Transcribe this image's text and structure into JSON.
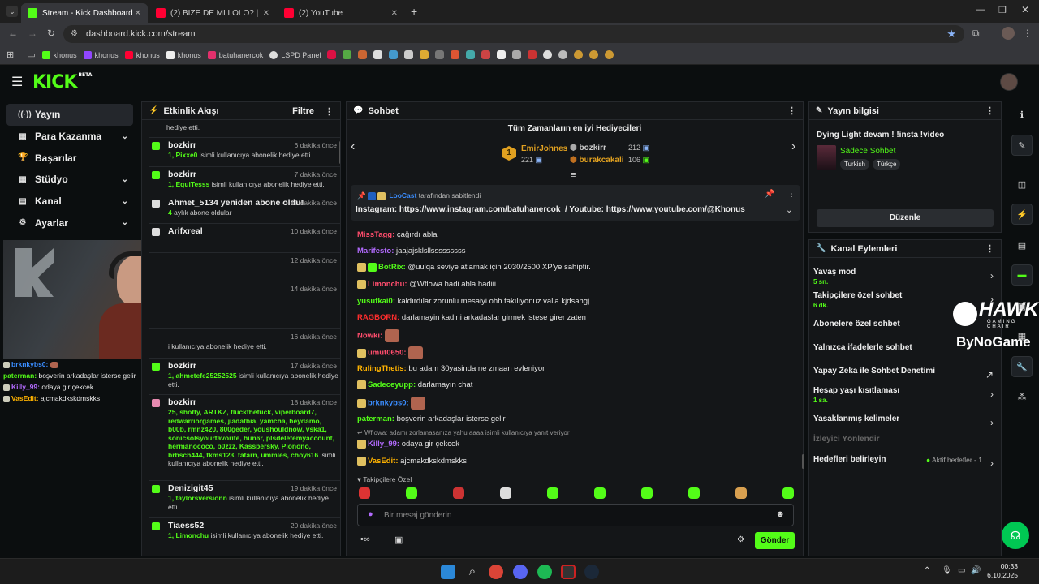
{
  "browser": {
    "tabs": [
      {
        "title": "Stream - Kick Dashboard",
        "color": "#53fc18"
      },
      {
        "title": "(2) BİZE DE Mİ LOLO? | 5Srider...",
        "color": "#ff0033"
      },
      {
        "title": "(2) YouTube",
        "color": "#ff0033"
      }
    ],
    "url": "dashboard.kick.com/stream",
    "bookmarks": [
      {
        "label": "khonus",
        "color": "#53fc18"
      },
      {
        "label": "khonus",
        "color": "#9146ff"
      },
      {
        "label": "khonus",
        "color": "#ff0033"
      },
      {
        "label": "khonus",
        "color": "#eeeeee"
      },
      {
        "label": "batuhanercok",
        "color": "#e1306c"
      },
      {
        "label": "LSPD Panel",
        "color": "#dddddd"
      }
    ]
  },
  "kick": {
    "logo": "KICK",
    "logo_badge": "BETA"
  },
  "nav": {
    "items": [
      {
        "label": "Yayın",
        "icon": "broadcast-icon",
        "glyph": "((·))",
        "chevron": false,
        "active": true
      },
      {
        "label": "Para Kazanma",
        "icon": "money-icon",
        "glyph": "▦",
        "chevron": true,
        "active": false
      },
      {
        "label": "Başarılar",
        "icon": "trophy-icon",
        "glyph": "🏆",
        "chevron": false,
        "active": false
      },
      {
        "label": "Stüdyo",
        "icon": "studio-icon",
        "glyph": "▦",
        "chevron": true,
        "active": false
      },
      {
        "label": "Kanal",
        "icon": "channel-icon",
        "glyph": "▤",
        "chevron": true,
        "active": false
      },
      {
        "label": "Ayarlar",
        "icon": "gear-icon",
        "glyph": "⚙",
        "chevron": true,
        "active": false
      }
    ]
  },
  "overlay_chat": [
    {
      "user": "brknkybs0:",
      "text": "",
      "color": "#3a8dff"
    },
    {
      "user": "paterman:",
      "text": "boşverin arkadaşlar isterse gelir",
      "color": "#53fc18"
    },
    {
      "user": "Killy_99:",
      "text": "odaya gir çekcek",
      "color": "#b36bff"
    },
    {
      "user": "VasEdit:",
      "text": "ajcmakdkskdmskks",
      "color": "#ffb300"
    }
  ],
  "activity": {
    "title": "Etkinlik Akışı",
    "filter_label": "Filtre",
    "top_cut": "hediye etti.",
    "events": [
      {
        "name": "bozkirr",
        "time": "6 dakika önce",
        "count": "1,",
        "user": "Pixxe0",
        "desc": "isimli kullanıcıya abonelik hediye etti.",
        "icon_color": "#53fc18"
      },
      {
        "name": "bozkirr",
        "time": "7 dakika önce",
        "count": "1,",
        "user": "EquiTesss",
        "desc": "isimli kullanıcıya abonelik hediye etti.",
        "icon_color": "#53fc18"
      },
      {
        "name": "Ahmet_5134 yeniden abone oldu!",
        "time": "10 dakika önce",
        "count": "4",
        "user": "",
        "desc": "aylık abone oldular",
        "icon_color": "#dddddd"
      },
      {
        "name": "Arifxreal",
        "time": "10 dakika önce",
        "count": "",
        "user": "",
        "desc": "",
        "icon_color": "#dddddd"
      },
      {
        "name": "",
        "time": "12 dakika önce",
        "count": "",
        "user": "",
        "desc": "",
        "icon_color": "#141618"
      },
      {
        "name": "",
        "time": "14 dakika önce",
        "count": "",
        "user": "",
        "desc": "",
        "icon_color": "#141618"
      },
      {
        "name": "",
        "time": "16 dakika önce",
        "count": "",
        "user": "",
        "desc": "i kullanıcıya abonelik hediye etti.",
        "icon_color": "#141618"
      },
      {
        "name": "bozkirr",
        "time": "17 dakika önce",
        "count": "1,",
        "user": "ahmetefe25252525",
        "desc": "isimli kullanıcıya abonelik hediye etti.",
        "icon_color": "#53fc18"
      },
      {
        "name": "bozkirr",
        "time": "18 dakika önce",
        "count": "25,",
        "user": "shotty, ARTKZ, fluckthefuck, viperboard7, redwarriorgames, jiadatbia, yamcha, heydamo, b00b, rmnz420, 800geder, youshouldnow, vska1, sonicsolsyourfavorite, hun6r, plsdeletemyaccount, hermanococo, b0zzz, Kasspersky, Pionono, brbsch444, tkms123, tatarn, ummles, choy616",
        "desc": "isimli kullanıcıya abonelik hediye etti.",
        "icon_color": "#e88ab0"
      },
      {
        "name": "Denizigit45",
        "time": "19 dakika önce",
        "count": "1,",
        "user": "taylorsversionn",
        "desc": "isimli kullanıcıya abonelik hediye etti.",
        "icon_color": "#53fc18"
      },
      {
        "name": "Tiaess52",
        "time": "20 dakika önce",
        "count": "1,",
        "user": "Limonchu",
        "desc": "isimli kullanıcıya abonelik hediye etti.",
        "icon_color": "#53fc18"
      }
    ]
  },
  "chat": {
    "title": "Sohbet",
    "gifters_title": "Tüm Zamanların en iyi Hediyecileri",
    "top_gifter": {
      "rank": "1",
      "name": "EmirJohnes",
      "count": "221"
    },
    "gifters": [
      {
        "name": "bozkirr",
        "count": "212"
      },
      {
        "name": "burakcakali",
        "count": "106"
      }
    ],
    "pinned_by": "LooCast",
    "pinned_suffix": "tarafından sabitlendi",
    "pinned_prefix1": "Instagram:",
    "pinned_link1": "https://www.instagram.com/batuhanercok_/",
    "pinned_prefix2": "Youtube:",
    "pinned_link2": "https://www.youtube.com/@Khonus",
    "messages": [
      {
        "user": "MissTagg:",
        "text": "çağırdı abla",
        "color": "#ff4d6d",
        "badges": 0,
        "emote": false
      },
      {
        "user": "Marifesto:",
        "text": "jaajajsklsllsssssssss",
        "color": "#b36bff",
        "badges": 0,
        "emote": false
      },
      {
        "user": "BotRix:",
        "text": "@uulqa seviye atlamak için 2030/2500 XP'ye sahiptir.",
        "color": "#53fc18",
        "badges": 2,
        "emote": false
      },
      {
        "user": "Limonchu:",
        "text": "@Wflowa hadi abla hadiii",
        "color": "#ff4d6d",
        "badges": 1,
        "emote": false
      },
      {
        "user": "yusufkai0:",
        "text": "kaldırdılar zorunlu mesaiyi ohh takılıyonuz valla kjdsahgj",
        "color": "#53fc18",
        "badges": 0,
        "emote": false
      },
      {
        "user": "RAGBORN:",
        "text": "darlamayin kadini arkadaslar girmek istese girer zaten",
        "color": "#ff2d2d",
        "badges": 0,
        "emote": false
      },
      {
        "user": "Nowki:",
        "text": "",
        "color": "#ff4d6d",
        "badges": 0,
        "emote": true
      },
      {
        "user": "umut0650:",
        "text": "",
        "color": "#ff4d6d",
        "badges": 1,
        "emote": true
      },
      {
        "user": "RulingThetis:",
        "text": "bu adam 30yasinda ne zmaan evleniyor",
        "color": "#ffb300",
        "badges": 0,
        "emote": false
      },
      {
        "user": "Sadeceyupp:",
        "text": "darlamayın chat",
        "color": "#53fc18",
        "badges": 1,
        "emote": false
      },
      {
        "user": "brknkybs0:",
        "text": "",
        "color": "#3a8dff",
        "badges": 1,
        "emote": true
      },
      {
        "user": "paterman:",
        "text": "boşverin arkadaşlar isterse gelir",
        "color": "#53fc18",
        "badges": 0,
        "emote": false
      },
      {
        "user": "Killy_99:",
        "text": "odaya gir çekcek",
        "color": "#b36bff",
        "badges": 1,
        "emote": false
      },
      {
        "user": "VasEdit:",
        "text": "ajcmakdkskdmskks",
        "color": "#ffb300",
        "badges": 1,
        "emote": false
      }
    ],
    "reply_note": "Wflowa: adamı zorlamasanıza yahu aaaa isimli kullanıcıya yanıt veriyor",
    "followers_only": "Takipçilere Özel",
    "input_placeholder": "Bir mesaj gönderin",
    "send_label": "Gönder"
  },
  "stream_info": {
    "title": "Yayın bilgisi",
    "stream_title": "Dying Light devam ! !insta !video",
    "category": "Sadece Sohbet",
    "tags": [
      "Turkish",
      "Türkçe"
    ],
    "edit_label": "Düzenle"
  },
  "channel_actions": {
    "title": "Kanal Eylemleri",
    "items": [
      {
        "label": "Yavaş mod",
        "sub": "5 sn.",
        "chevron": "›"
      },
      {
        "label": "Takipçilere özel sohbet",
        "sub": "6 dk.",
        "chevron": "›"
      },
      {
        "label": "Abonelere özel sohbet",
        "sub": "",
        "chevron": ""
      },
      {
        "label": "Yalnızca ifadelerle sohbet",
        "sub": "",
        "chevron": ""
      },
      {
        "label": "Yapay Zeka ile Sohbet Denetimi",
        "sub": "",
        "chevron": "↗"
      },
      {
        "label": "Hesap yaşı kısıtlaması",
        "sub": "1 sa.",
        "chevron": "›"
      },
      {
        "label": "Yasaklanmış kelimeler",
        "sub": "",
        "chevron": "›"
      },
      {
        "label": "İzleyici Yönlendir",
        "sub": "",
        "chevron": ""
      },
      {
        "label": "Hedefleri belirleyin",
        "sub": "",
        "chevron": "›"
      }
    ],
    "goals_status": "Aktif hedefler - 1"
  },
  "overlay_brand": {
    "hawk": "HAWK",
    "hawk_sub": "GAMING CHAIR",
    "bynogame": "ByNoGame"
  },
  "taskbar": {
    "time": "00:33",
    "date": "6.10.2025"
  },
  "colors": {
    "accent": "#53fc18",
    "panel": "#141618",
    "bg": "#0b0e0f"
  }
}
